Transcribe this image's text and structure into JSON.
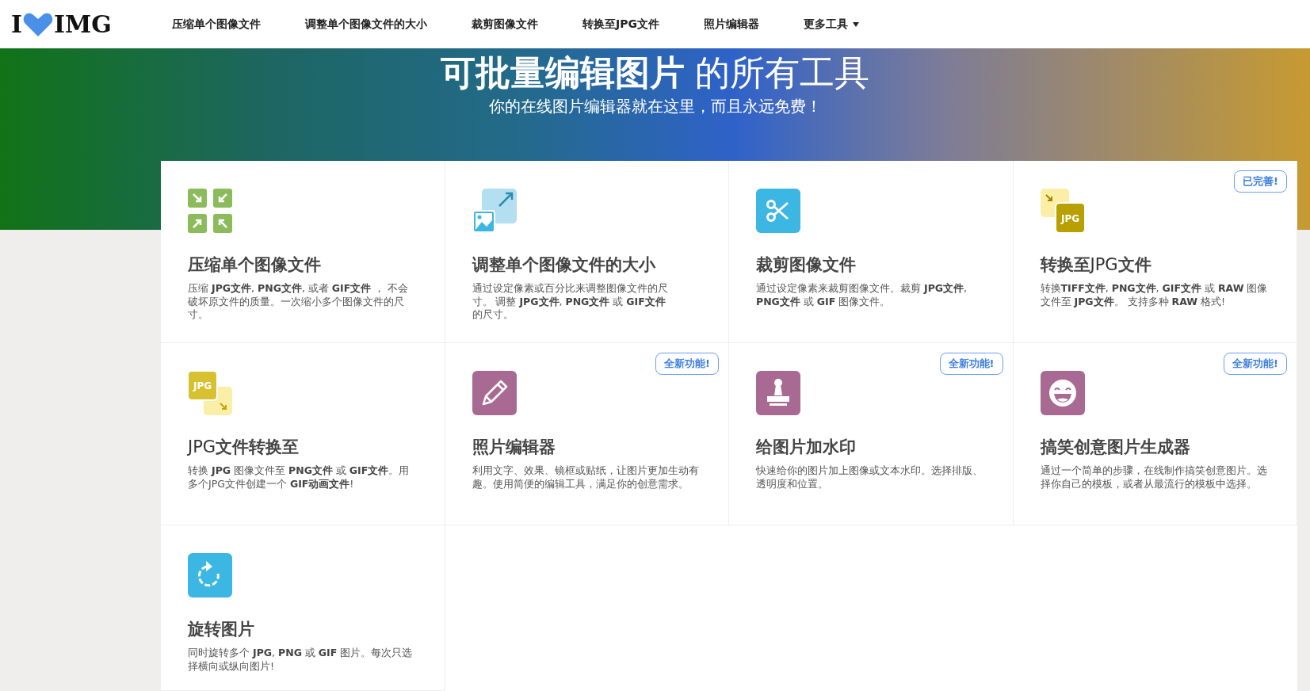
{
  "nav": {
    "logo": {
      "left": "I",
      "right": "IMG"
    },
    "items": [
      {
        "label": "压缩单个图像文件",
        "dropdown": false
      },
      {
        "label": "调整单个图像文件的大小",
        "dropdown": false
      },
      {
        "label": "裁剪图像文件",
        "dropdown": false
      },
      {
        "label": "转换至JPG文件",
        "dropdown": false
      },
      {
        "label": "照片编辑器",
        "dropdown": false
      },
      {
        "label": "更多工具",
        "dropdown": true
      }
    ]
  },
  "hero": {
    "title": "**可批量编辑图片** 的所有工具",
    "subtitle": "你的在线图片编辑器就在这里，而且永远免费！"
  },
  "tools": [
    {
      "kind": "compress",
      "title": "**压缩单个图像文件**",
      "description": "压缩 **JPG文件**, **PNG文件**, 或者 **GIF文件** ， 不会破坏原文件的质量。一次缩小多个图像文件的尺寸。"
    },
    {
      "kind": "resize",
      "title": "**调整单个图像文件的大小**",
      "description": "通过设定像素或百分比来调整图像文件的尺寸。 调整 **JPG文件**, **PNG文件** 或 **GIF文件**的尺寸。"
    },
    {
      "kind": "crop",
      "title": "**裁剪图像文件**",
      "description": "通过设定像素来裁剪图像文件。裁剪 **JPG文件**, **PNG文件** 或 **GIF** 图像文件。"
    },
    {
      "kind": "to-jpg",
      "icon_text": "JPG",
      "badge": "已完善!",
      "title": "**转换至**JPG**文件**",
      "description": "转换**TIFF文件**, **PNG文件**, **GIF文件** 或 **RAW** 图像文件至 **JPG文件**。 支持多种 **RAW** 格式!"
    },
    {
      "kind": "from-jpg",
      "icon_text": "JPG",
      "title": "JPG**文件转换至**",
      "description": "转换 **JPG** 图像文件至 **PNG文件** 或 **GIF文件**。用多个JPG文件创建一个 **GIF动画文件**!"
    },
    {
      "kind": "editor",
      "badge": "全新功能!",
      "title": "**照片编辑器**",
      "description": "利用文字、效果、镜框或贴纸，让图片更加生动有趣。使用简便的编辑工具，满足你的创意需求。"
    },
    {
      "kind": "watermark",
      "badge": "全新功能!",
      "title": "**给图片加水印**",
      "description": "快速给你的图片加上图像或文本水印。选择排版、透明度和位置。"
    },
    {
      "kind": "meme",
      "badge": "全新功能!",
      "title": "**搞笑创意图片生成器**",
      "description": "通过一个简单的步骤，在线制作搞笑创意图片。选择你自己的模板，或者从最流行的模板中选择。"
    },
    {
      "kind": "rotate",
      "title": "**旋转图片**",
      "description": "同时旋转多个 **JPG**, **PNG** 或 **GIF** 图片。每次只选择横向或纵向图片!"
    }
  ]
}
